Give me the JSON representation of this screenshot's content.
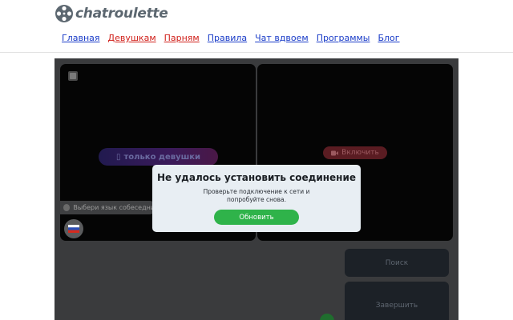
{
  "logo": {
    "text": "chatroulette"
  },
  "nav": {
    "items": [
      {
        "label": "Главная",
        "color": "#1a3cc8"
      },
      {
        "label": "Девушкам",
        "color": "#d0201a"
      },
      {
        "label": "Парням",
        "color": "#d0201a"
      },
      {
        "label": "Правила",
        "color": "#1a3cc8"
      },
      {
        "label": "Чат вдвоем",
        "color": "#1a3cc8"
      },
      {
        "label": "Программы",
        "color": "#1a3cc8"
      },
      {
        "label": "Блог",
        "color": "#1a3cc8"
      }
    ]
  },
  "video": {
    "girls_only_label": "только девушки",
    "enable_label": "Включить",
    "language_prompt": "Выбери язык собеседника",
    "language_flag": "ru-flag-icon"
  },
  "controls": {
    "search_label": "Поиск",
    "finish_label": "Завершить"
  },
  "modal": {
    "title": "Не удалось установить соединение",
    "message": "Проверьте подключение к сети и попробуйте снова.",
    "button_label": "Обновить"
  },
  "colors": {
    "accent_green": "#2fb34a",
    "link_blue": "#1a3cc8",
    "link_red": "#d0201a"
  }
}
